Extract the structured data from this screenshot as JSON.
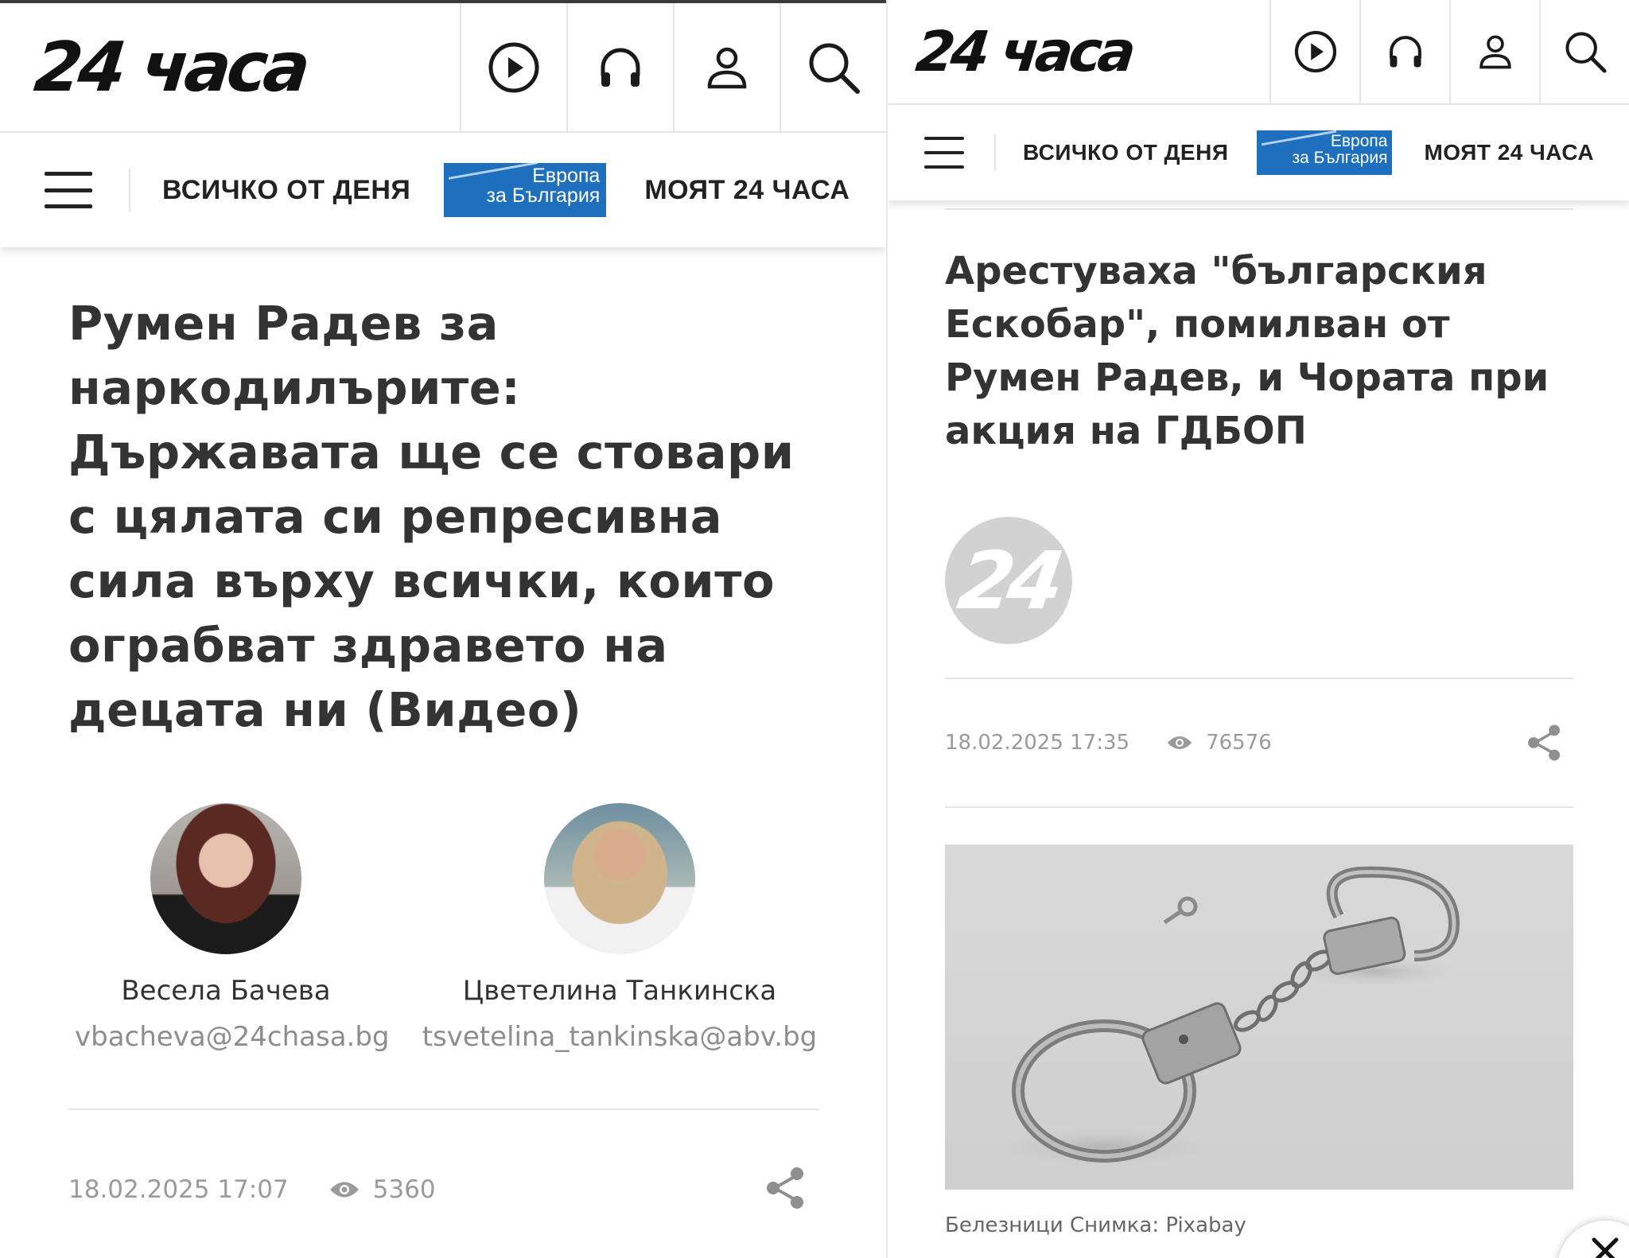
{
  "left": {
    "logo": "24 часа",
    "nav": {
      "all_today": "ВСИЧКО ОТ ДЕНЯ",
      "eu_line1": "Европа",
      "eu_line2": "за България",
      "my24": "МОЯТ 24 ЧАСА"
    },
    "title": "Румен Радев за наркодилърите: Държавата ще се стовари с цялата си репресивна сила върху всички, които ограбват здравето на децата ни (Видео)",
    "authors": [
      {
        "name": "Весела Бачева",
        "email": "vbacheva@24chasa.bg"
      },
      {
        "name": "Цветелина Танкинска",
        "email": "tsvetelina_tankinska@abv.bg"
      }
    ],
    "meta": {
      "datetime": "18.02.2025 17:07",
      "views": "5360"
    }
  },
  "right": {
    "logo": "24 часа",
    "nav": {
      "all_today": "ВСИЧКО ОТ ДЕНЯ",
      "eu_line1": "Европа",
      "eu_line2": "за България",
      "my24": "МОЯТ 24 ЧАСА"
    },
    "title": "Арестуваха \"българския Ескобар\", помилван от Румен Радев, и Чората при акция на ГДБОП",
    "source_logo": "24",
    "meta": {
      "datetime": "18.02.2025 17:35",
      "views": "76576"
    },
    "caption": "Белезници Снимка: Pixabay"
  },
  "icons": [
    "play-icon",
    "headphones-icon",
    "user-icon",
    "search-icon",
    "menu-icon",
    "eye-icon",
    "share-icon",
    "close-icon"
  ],
  "colors": {
    "eu_badge": "#1f6fbf",
    "text": "#333333",
    "muted": "#9a9a9a"
  }
}
